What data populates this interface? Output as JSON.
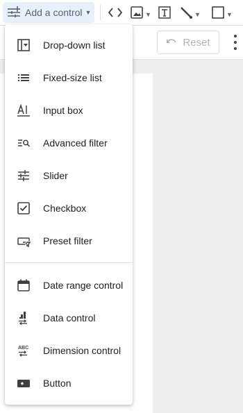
{
  "toolbar": {
    "add_control_label": "Add a control",
    "icons": [
      "add-control-icon",
      "code-embed-icon",
      "image-icon",
      "text-box-icon",
      "line-icon",
      "rectangle-icon"
    ]
  },
  "subbar": {
    "reset_label": "Reset"
  },
  "menu": {
    "items": [
      {
        "label": "Drop-down list",
        "icon": "dropdown-list-icon"
      },
      {
        "label": "Fixed-size list",
        "icon": "fixed-size-list-icon"
      },
      {
        "label": "Input box",
        "icon": "input-box-icon"
      },
      {
        "label": "Advanced filter",
        "icon": "advanced-filter-icon"
      },
      {
        "label": "Slider",
        "icon": "slider-icon"
      },
      {
        "label": "Checkbox",
        "icon": "checkbox-icon"
      },
      {
        "label": "Preset filter",
        "icon": "preset-filter-icon"
      },
      {
        "label": "Date range control",
        "icon": "calendar-icon"
      },
      {
        "label": "Data control",
        "icon": "data-control-icon"
      },
      {
        "label": "Dimension control",
        "icon": "dimension-control-icon"
      },
      {
        "label": "Button",
        "icon": "button-icon"
      }
    ]
  },
  "colors": {
    "active_button_bg": "#e8f0fe",
    "icon_gray": "#5f6368",
    "canvas_bg": "#eeeeee"
  }
}
